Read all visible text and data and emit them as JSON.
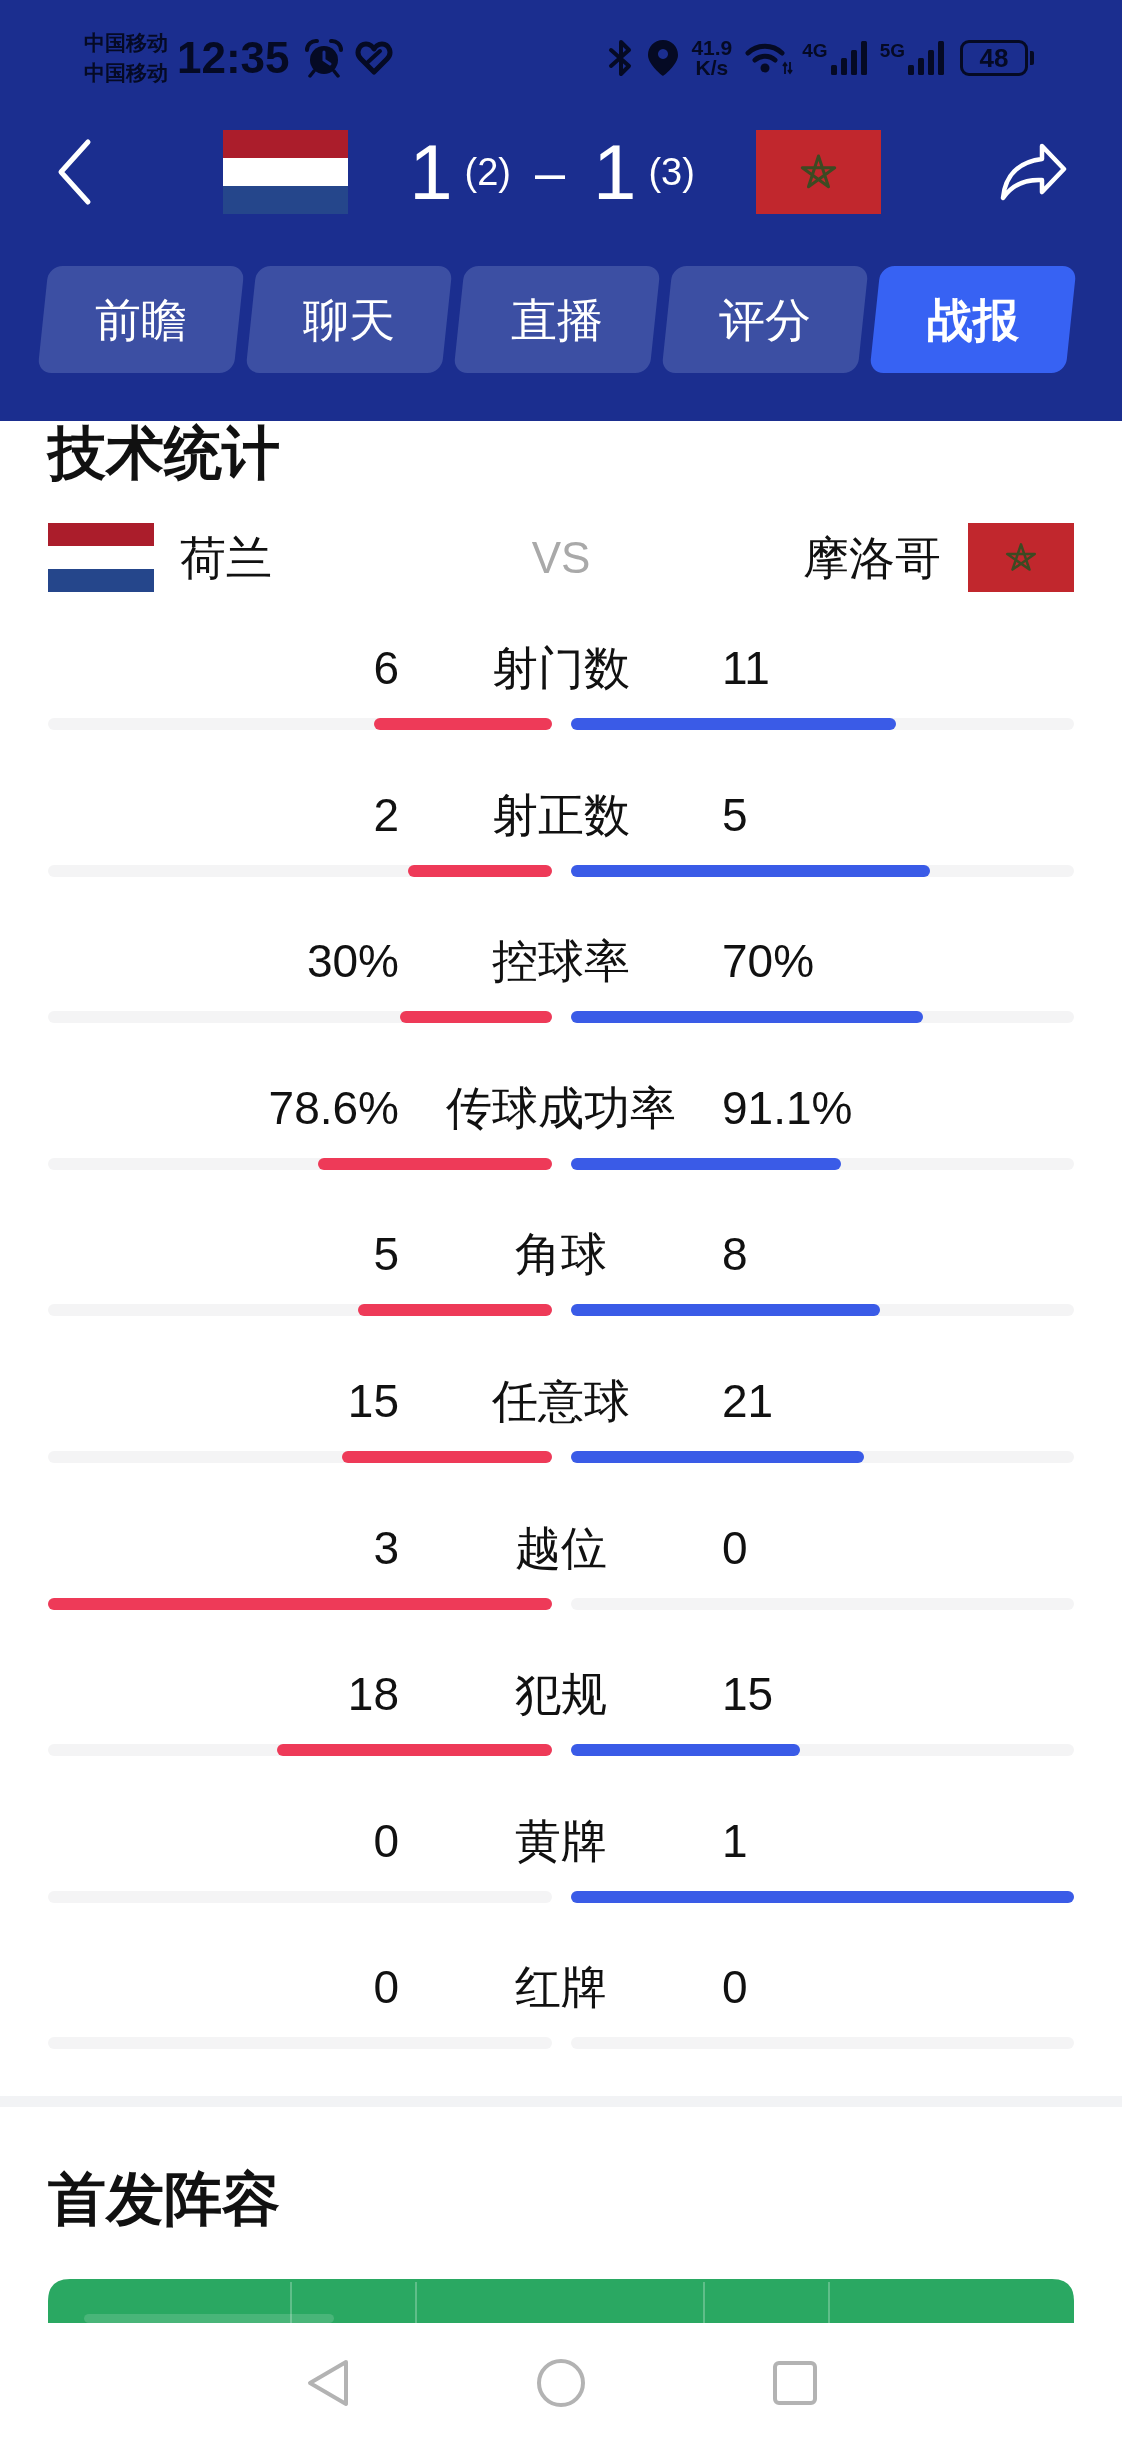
{
  "status_bar": {
    "carriers": [
      "中国移动",
      "中国移动"
    ],
    "time": "12:35",
    "net_speed": "41.9",
    "net_speed_unit": "K/s",
    "networks": [
      "4G",
      "5G"
    ],
    "battery": "48"
  },
  "match_header": {
    "home_score": "1",
    "home_penalties": "(2)",
    "separator": "–",
    "away_score": "1",
    "away_penalties": "(3)"
  },
  "tabs": [
    {
      "label": "前瞻",
      "selected": false
    },
    {
      "label": "聊天",
      "selected": false
    },
    {
      "label": "直播",
      "selected": false
    },
    {
      "label": "评分",
      "selected": false
    },
    {
      "label": "战报",
      "selected": true
    }
  ],
  "stats_section": {
    "title": "技术统计",
    "home_team": "荷兰",
    "vs": "VS",
    "away_team": "摩洛哥",
    "rows": [
      {
        "label": "射门数",
        "home": {
          "value": "6",
          "level": 0.353
        },
        "away": {
          "value": "11",
          "level": 0.647
        }
      },
      {
        "label": "射正数",
        "home": {
          "value": "2",
          "level": 0.286
        },
        "away": {
          "value": "5",
          "level": 0.714
        }
      },
      {
        "label": "控球率",
        "home": {
          "value": "30%",
          "level": 0.3
        },
        "away": {
          "value": "70%",
          "level": 0.7
        }
      },
      {
        "label": "传球成功率",
        "home": {
          "value": "78.6%",
          "level": 0.463
        },
        "away": {
          "value": "91.1%",
          "level": 0.537
        }
      },
      {
        "label": "角球",
        "home": {
          "value": "5",
          "level": 0.385
        },
        "away": {
          "value": "8",
          "level": 0.615
        }
      },
      {
        "label": "任意球",
        "home": {
          "value": "15",
          "level": 0.417
        },
        "away": {
          "value": "21",
          "level": 0.583
        }
      },
      {
        "label": "越位",
        "home": {
          "value": "3",
          "level": 1
        },
        "away": {
          "value": "0"
        }
      },
      {
        "label": "犯规",
        "home": {
          "value": "18",
          "level": 0.545
        },
        "away": {
          "value": "15",
          "level": 0.455
        }
      },
      {
        "label": "黄牌",
        "home": {
          "value": "0"
        },
        "away": {
          "value": "1",
          "level": 1
        }
      },
      {
        "label": "红牌",
        "home": {
          "value": "0"
        },
        "away": {
          "value": "0"
        }
      }
    ]
  },
  "lineup_section": {
    "title": "首发阵容"
  }
}
